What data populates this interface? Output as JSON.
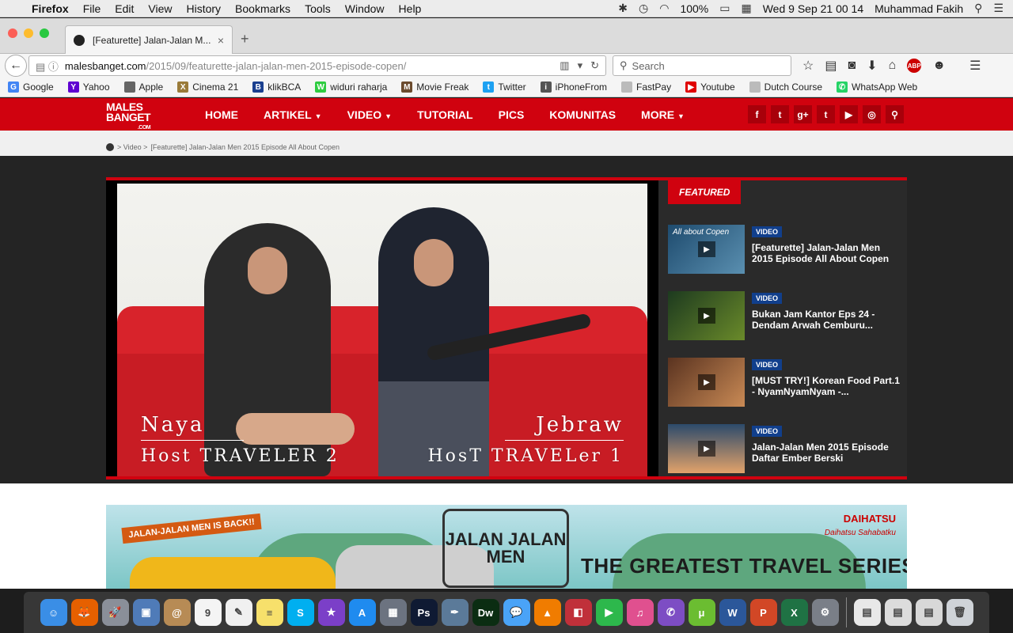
{
  "menubar": {
    "app": "Firefox",
    "items": [
      "File",
      "Edit",
      "View",
      "History",
      "Bookmarks",
      "Tools",
      "Window",
      "Help"
    ],
    "battery": "100%",
    "datetime": "Wed 9 Sep  21 00 14",
    "user": "Muhammad Fakih"
  },
  "tab": {
    "title": "[Featurette] Jalan-Jalan M..."
  },
  "url": {
    "host": "malesbanget.com",
    "path": "/2015/09/featurette-jalan-jalan-men-2015-episode-copen/"
  },
  "search": {
    "placeholder": "Search"
  },
  "bookmarks": [
    {
      "label": "Google",
      "color": "#4285f4",
      "glyph": "G"
    },
    {
      "label": "Yahoo",
      "color": "#5f01d1",
      "glyph": "Y"
    },
    {
      "label": "Apple",
      "color": "#666666",
      "glyph": ""
    },
    {
      "label": "Cinema 21",
      "color": "#9a7b3a",
      "glyph": "X"
    },
    {
      "label": "klikBCA",
      "color": "#1a3f8f",
      "glyph": "B"
    },
    {
      "label": "widuri raharja",
      "color": "#2ecc40",
      "glyph": "W"
    },
    {
      "label": "Movie Freak",
      "color": "#6b4b2e",
      "glyph": "M"
    },
    {
      "label": "Twitter",
      "color": "#1da1f2",
      "glyph": "t"
    },
    {
      "label": "iPhoneFrom",
      "color": "#555555",
      "glyph": "i"
    },
    {
      "label": "FastPay",
      "color": "#bbbbbb",
      "glyph": ""
    },
    {
      "label": "Youtube",
      "color": "#e00000",
      "glyph": "▶"
    },
    {
      "label": "Dutch Course",
      "color": "#bbbbbb",
      "glyph": ""
    },
    {
      "label": "WhatsApp Web",
      "color": "#25d366",
      "glyph": "✆"
    }
  ],
  "site": {
    "logo_top": "MALES",
    "logo_bottom": "BANGET",
    "logo_com": ".COM",
    "nav": [
      {
        "label": "HOME",
        "caret": ""
      },
      {
        "label": "ARTIKEL",
        "caret": "▼"
      },
      {
        "label": "VIDEO",
        "caret": "▼"
      },
      {
        "label": "TUTORIAL",
        "caret": ""
      },
      {
        "label": "PICS",
        "caret": ""
      },
      {
        "label": "KOMUNITAS",
        "caret": ""
      },
      {
        "label": "MORE",
        "caret": "▼"
      }
    ],
    "social": [
      "f",
      "t",
      "g+",
      "t",
      "▶",
      "◎",
      "⚲"
    ],
    "breadcrumb": [
      "> Video >",
      "[Featurette] Jalan-Jalan Men 2015 Episode All About Copen"
    ]
  },
  "video": {
    "left_name": "Naya",
    "left_role": "Host TRAVELER 2",
    "right_name": "Jebraw",
    "right_role": "HosT TRAVELer 1"
  },
  "featured": {
    "label": "FEATURED",
    "items": [
      {
        "badge": "VIDEO",
        "title": "[Featurette] Jalan-Jalan Men 2015 Episode All About Copen",
        "thumb_text": "All about Copen"
      },
      {
        "badge": "VIDEO",
        "title": "Bukan Jam Kantor Eps 24 - Dendam Arwah Cemburu...",
        "thumb_text": ""
      },
      {
        "badge": "VIDEO",
        "title": "[MUST TRY!] Korean Food Part.1 - NyamNyamNyam -...",
        "thumb_text": ""
      },
      {
        "badge": "VIDEO",
        "title": "Jalan-Jalan Men 2015 Episode Daftar Ember Berski",
        "thumb_text": ""
      }
    ]
  },
  "banner": {
    "tag": "JALAN-JALAN MEN IS BACK!!",
    "stamp": "JALAN JALAN MEN",
    "slogan": "THE GREATEST TRAVEL SERIES EVER",
    "brand": "DAIHATSU",
    "brand_sub": "Daihatsu Sahabatku"
  },
  "dock": [
    {
      "name": "finder",
      "color": "#3a8ee6",
      "glyph": "☺"
    },
    {
      "name": "firefox",
      "color": "#e66000",
      "glyph": "🦊"
    },
    {
      "name": "launchpad",
      "color": "#8a8f99",
      "glyph": "🚀"
    },
    {
      "name": "preview",
      "color": "#4f7bb8",
      "glyph": "▣"
    },
    {
      "name": "contacts",
      "color": "#b78b55",
      "glyph": "@"
    },
    {
      "name": "calendar",
      "color": "#f4f4f4",
      "glyph": "9"
    },
    {
      "name": "textedit",
      "color": "#f0f0f0",
      "glyph": "✎"
    },
    {
      "name": "notes",
      "color": "#f7e06b",
      "glyph": "≡"
    },
    {
      "name": "skype",
      "color": "#00aff0",
      "glyph": "S"
    },
    {
      "name": "imovie",
      "color": "#7b3fc8",
      "glyph": "★"
    },
    {
      "name": "app-store",
      "color": "#1f8bef",
      "glyph": "A"
    },
    {
      "name": "photo-browser",
      "color": "#6c7380",
      "glyph": "▦"
    },
    {
      "name": "photoshop",
      "color": "#0f1a33",
      "glyph": "Ps"
    },
    {
      "name": "pen-tool",
      "color": "#5b7a99",
      "glyph": "✒"
    },
    {
      "name": "dreamweaver",
      "color": "#0b2d12",
      "glyph": "Dw"
    },
    {
      "name": "messages",
      "color": "#4aa3f7",
      "glyph": "💬"
    },
    {
      "name": "vlc",
      "color": "#f07c00",
      "glyph": "▲"
    },
    {
      "name": "photo-booth",
      "color": "#c0303a",
      "glyph": "◧"
    },
    {
      "name": "facetime",
      "color": "#2db84c",
      "glyph": "▶"
    },
    {
      "name": "itunes",
      "color": "#e0508f",
      "glyph": "♫"
    },
    {
      "name": "viber",
      "color": "#7d4dc4",
      "glyph": "✆"
    },
    {
      "name": "utorrent",
      "color": "#6bbd31",
      "glyph": "μ"
    },
    {
      "name": "word",
      "color": "#2b579a",
      "glyph": "W"
    },
    {
      "name": "powerpoint",
      "color": "#d24726",
      "glyph": "P"
    },
    {
      "name": "excel",
      "color": "#1f7244",
      "glyph": "X"
    },
    {
      "name": "system-preferences",
      "color": "#7a7f88",
      "glyph": "⚙"
    },
    {
      "name": "documents",
      "color": "#e8e8e8",
      "glyph": "▤"
    },
    {
      "name": "downloads",
      "color": "#dcdcdc",
      "glyph": "▤"
    },
    {
      "name": "screenshots",
      "color": "#d8d8d8",
      "glyph": "▤"
    },
    {
      "name": "trash",
      "color": "#cfd3d8",
      "glyph": "🗑"
    }
  ]
}
